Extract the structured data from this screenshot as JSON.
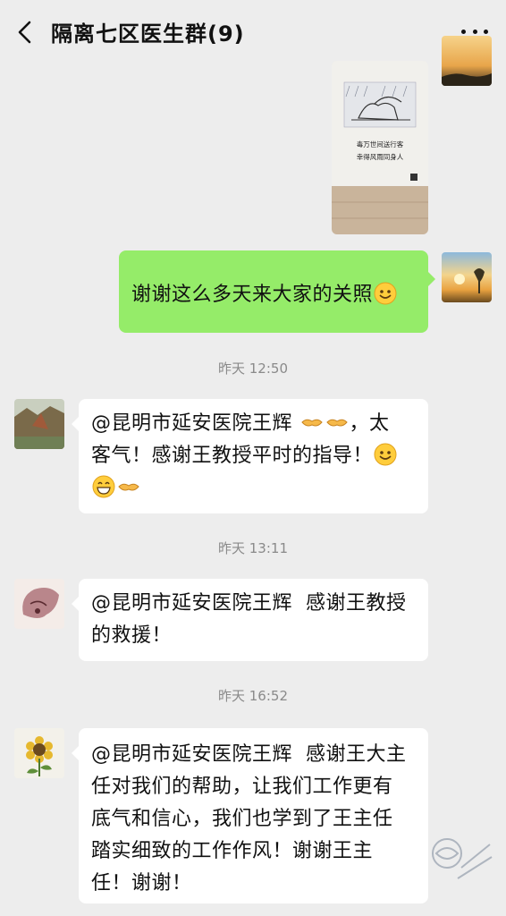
{
  "header": {
    "title": "隔离七区医生群(9)",
    "back_icon": "chevron-left-icon",
    "more_icon": "more-dots-icon"
  },
  "image_message": {
    "caption_line1": "毒万世间送行客",
    "caption_line2": "幸得风雨同身人"
  },
  "messages": [
    {
      "side": "right",
      "text": "谢谢这么多天来大家的关照",
      "emoji": [
        "smile"
      ]
    },
    {
      "time": "昨天 12:50"
    },
    {
      "side": "left",
      "mention": "@昆明市延安医院王辉",
      "text_after_emoji": "，太",
      "line2": "客气！感谢王教授平时的指导！",
      "emoji": [
        "handshake",
        "handshake",
        "smile",
        "grin",
        "handshake"
      ]
    },
    {
      "time": "昨天 13:11"
    },
    {
      "side": "left",
      "mention": "@昆明市延安医院王辉",
      "text": "感谢王教授",
      "line2": "的救援！"
    },
    {
      "time": "昨天 16:52"
    },
    {
      "side": "left",
      "mention": "@昆明市延安医院王辉",
      "text": "感谢王大主",
      "lines": [
        "任对我们的帮助，让我们工作更有",
        "底气和信心，我们也学到了王主任",
        "踏实细致的工作作风！谢谢王主",
        "任！谢谢！"
      ]
    }
  ],
  "colors": {
    "background": "#ededed",
    "bubble_self": "#95ec69",
    "bubble_other": "#ffffff",
    "timestamp": "#8a8a8a"
  }
}
